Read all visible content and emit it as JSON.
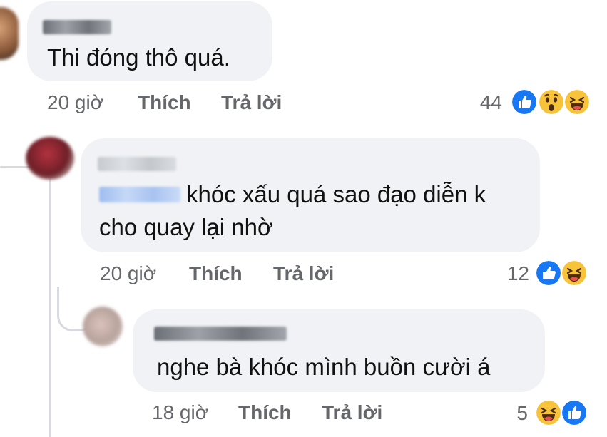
{
  "comments": [
    {
      "id": "c1",
      "author": "",
      "text": "Thi đóng thô quá.",
      "time": "20 giờ",
      "like_label": "Thích",
      "reply_label": "Trả lời",
      "reaction_count": "44",
      "reactions": [
        "like-icon",
        "wow-icon",
        "haha-icon"
      ]
    },
    {
      "id": "c2",
      "author": "",
      "mention": "",
      "text": "khóc xấu quá sao đạo diễn k cho quay lại nhờ",
      "text_line1": "khóc xấu quá sao đạo diễn k",
      "text_line2": "cho quay lại nhờ",
      "time": "20 giờ",
      "like_label": "Thích",
      "reply_label": "Trả lời",
      "reaction_count": "12",
      "reactions": [
        "like-icon",
        "haha-icon"
      ]
    },
    {
      "id": "c3",
      "author": "",
      "text": "nghe bà khóc mình buồn cười á",
      "time": "18 giờ",
      "like_label": "Thích",
      "reply_label": "Trả lời",
      "reaction_count": "5",
      "reactions": [
        "haha-icon",
        "like-icon"
      ]
    }
  ],
  "colors": {
    "bubble": "#f0f2f5",
    "meta_text": "#65676b",
    "like_blue": "#1877f2",
    "haha_yellow": "#f7c33b",
    "thread_line": "#d8dadf"
  }
}
